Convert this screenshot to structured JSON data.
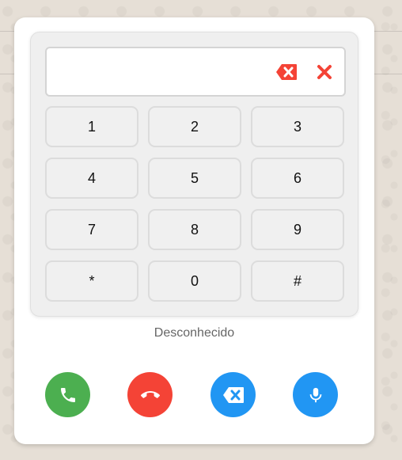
{
  "dialer": {
    "display_value": "",
    "status_text": "Desconhecido",
    "keys": [
      "1",
      "2",
      "3",
      "4",
      "5",
      "6",
      "7",
      "8",
      "9",
      "*",
      "0",
      "#"
    ]
  },
  "icons": {
    "display_backspace": "backspace-icon",
    "display_clear": "close-icon",
    "call": "phone-icon",
    "hangup": "call-end-icon",
    "erase": "backspace-icon",
    "mic": "microphone-icon"
  },
  "colors": {
    "call": "#4caf50",
    "hangup": "#f44336",
    "erase": "#2196f3",
    "mic": "#2196f3",
    "display_icons": "#f44336"
  }
}
